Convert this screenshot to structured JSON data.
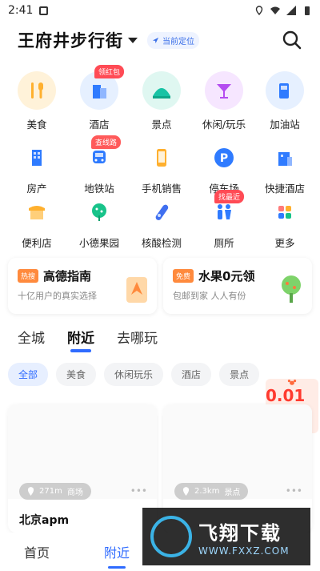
{
  "status": {
    "time": "2:41"
  },
  "header": {
    "title": "王府井步行街",
    "location_label": "当前定位"
  },
  "grid": [
    {
      "label": "美食",
      "icon": "fork-knife-icon",
      "color": "#ffb02e"
    },
    {
      "label": "酒店",
      "icon": "hotel-building-icon",
      "color": "#2f7bff",
      "tag": "领红包"
    },
    {
      "label": "景点",
      "icon": "landscape-icon",
      "color": "#18c3a5"
    },
    {
      "label": "休闲/玩乐",
      "icon": "cocktail-icon",
      "color": "#b44cf0"
    },
    {
      "label": "加油站",
      "icon": "fuel-icon",
      "color": "#2f7bff"
    },
    {
      "label": "房产",
      "icon": "apartment-icon",
      "color": "#2f7bff"
    },
    {
      "label": "地铁站",
      "icon": "metro-icon",
      "color": "#ff5a5a",
      "tag": "查线路"
    },
    {
      "label": "手机销售",
      "icon": "phone-icon",
      "color": "#ffb02e"
    },
    {
      "label": "停车场",
      "icon": "parking-icon",
      "color": "#2f7bff"
    },
    {
      "label": "快捷酒店",
      "icon": "quick-hotel-icon",
      "color": "#2f7bff"
    },
    {
      "label": "便利店",
      "icon": "store-icon",
      "color": "#ffb02e"
    },
    {
      "label": "小德果园",
      "icon": "tree-icon",
      "color": "#18c38a"
    },
    {
      "label": "核酸检测",
      "icon": "test-tube-icon",
      "color": "#3f6ff0"
    },
    {
      "label": "厕所",
      "icon": "toilet-icon",
      "color": "#2f7bff",
      "tag": "找最近"
    },
    {
      "label": "更多",
      "icon": "more-grid-icon",
      "color": "#bbbbbb"
    }
  ],
  "promos": [
    {
      "badge": "热搜",
      "title": "高德指南",
      "subtitle": "十亿用户的真实选择"
    },
    {
      "badge": "免费",
      "title": "水果0元领",
      "subtitle": "包邮到家 人人有份"
    }
  ],
  "tabs": [
    "全城",
    "附近",
    "去哪玩"
  ],
  "active_tab": "附近",
  "chips": [
    "全部",
    "美食",
    "休闲玩乐",
    "酒店",
    "景点"
  ],
  "coupon": {
    "price": "0.01元"
  },
  "cards": [
    {
      "distance": "271m",
      "category": "商场",
      "name": "北京apm"
    },
    {
      "distance": "2.3km",
      "category": "景点",
      "name": ""
    }
  ],
  "bottom_nav": [
    "首页",
    "附近"
  ],
  "watermark": {
    "title": "飞翔下载",
    "url": "WWW.FXXZ.COM"
  },
  "colors": {
    "accent": "#2f6bff",
    "tag": "#ff4b55"
  }
}
